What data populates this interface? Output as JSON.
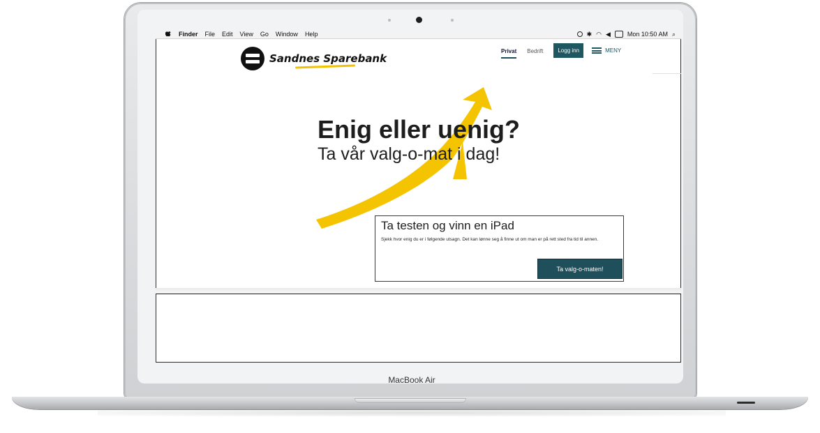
{
  "menubar": {
    "items": [
      "Finder",
      "File",
      "Edit",
      "View",
      "Go",
      "Window",
      "Help"
    ],
    "clock": "Mon 10:50 AM"
  },
  "site": {
    "logo_text": "Sandnes Sparebank",
    "nav": {
      "privat": "Privat",
      "bedrift": "Bedrift",
      "login": "Logg inn",
      "menu": "MENY"
    },
    "hero": {
      "title": "Enig eller uenig?",
      "subtitle": "Ta vår valg-o-mat i dag!"
    },
    "card": {
      "title": "Ta testen og vinn en iPad",
      "text": "Sjekk hvor enig du er i følgende utsagn. Det kan lønne seg å finne ut om man er på rett sted fra tid til annen.",
      "button": "Ta valg-o-maten!"
    }
  },
  "device": {
    "label": "MacBook Air"
  },
  "colors": {
    "accent": "#1e5661",
    "brand_yellow": "#f5c400",
    "text": "#1d1d1d"
  }
}
